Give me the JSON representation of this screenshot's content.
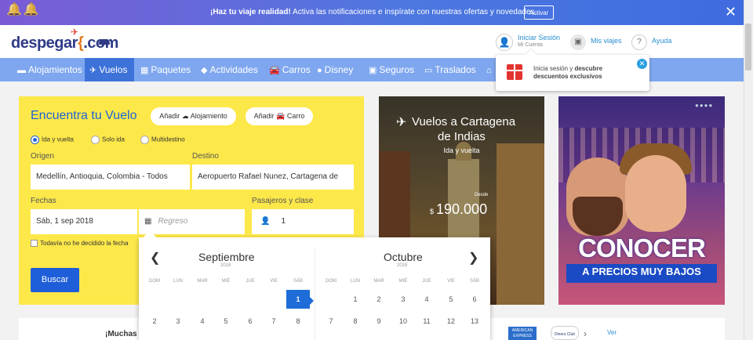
{
  "notification": {
    "bold": "¡Haz tu viaje realidad!",
    "text": " Activa las notificaciones e inspírate con nuestras ofertas y novedades.",
    "button": "Activar"
  },
  "header": {
    "logo_text": "despegar",
    "logo_suffix": ".com",
    "login_title": "Iniciar Sesión",
    "login_sub": "Mi Cuenta",
    "trips": "Mis viajes",
    "help": "Ayuda"
  },
  "nav": [
    {
      "label": "Alojamientos",
      "icon": "bed-icon"
    },
    {
      "label": "Vuelos",
      "icon": "plane-icon"
    },
    {
      "label": "Paquetes",
      "icon": "package-icon"
    },
    {
      "label": "Actividades",
      "icon": "ticket-icon"
    },
    {
      "label": "Carros",
      "icon": "car-icon"
    },
    {
      "label": "Disney",
      "icon": "mickey-icon"
    },
    {
      "label": "Seguros",
      "icon": "briefcase-icon"
    },
    {
      "label": "Traslados",
      "icon": "shuttle-icon"
    }
  ],
  "tooltip": {
    "pre": "Inicia sesión y ",
    "bold": "descubre descuentos exclusivos"
  },
  "search": {
    "title": "Encuentra tu Vuelo",
    "add_hotel": "Añadir ☁ Alojamiento",
    "add_car": "Añadir 🚘 Carro",
    "trip_types": [
      "Ida y vuelta",
      "Solo ida",
      "Multidestino"
    ],
    "origin_label": "Origen",
    "origin_value": "Medellín, Antioquia, Colombia - Todos",
    "dest_label": "Destino",
    "dest_value": "Aeropuerto Rafael Nunez, Cartagena de",
    "dates_label": "Fechas",
    "depart_value": "Sáb, 1 sep 2018",
    "return_placeholder": "Regreso",
    "pax_label": "Pasajeros y clase",
    "pax_value": "1",
    "undecided": "Todavía no he decidido la fecha",
    "submit": "Buscar"
  },
  "promo_flight": {
    "line1": "Vuelos a Cartagena",
    "line2": "de Indias",
    "line3": "Ida y vuelta",
    "desde": "Desde",
    "currency": "$",
    "price": "190.000"
  },
  "promo_city": {
    "big": "CONOCER",
    "small": "A PRECIOS MUY BAJOS"
  },
  "bottom": {
    "muchas": "¡Muchas",
    "amex": "AMERICAN EXPRESS",
    "diners": "Diners Club",
    "ver": "Ver"
  },
  "calendar": {
    "months": [
      {
        "name": "Septiembre",
        "year": "2018"
      },
      {
        "name": "Octubre",
        "year": "2018"
      }
    ],
    "dow": [
      "DOM",
      "LUN",
      "MAR",
      "MIÉ",
      "JUE",
      "VIE",
      "SÁB"
    ],
    "sep_row1": [
      "1"
    ],
    "sep_row2": [
      "2",
      "3",
      "4",
      "5",
      "6",
      "7",
      "8"
    ],
    "oct_row1": [
      "1",
      "2",
      "3",
      "4",
      "5",
      "6"
    ],
    "oct_row2": [
      "7",
      "8",
      "9",
      "10",
      "11",
      "12",
      "13"
    ],
    "selected_day": "1"
  },
  "colors": {
    "accent": "#1e63d6",
    "search_bg": "#fde84a",
    "nav_bg": "#7fa7ef",
    "nav_active": "#3d72d8"
  }
}
